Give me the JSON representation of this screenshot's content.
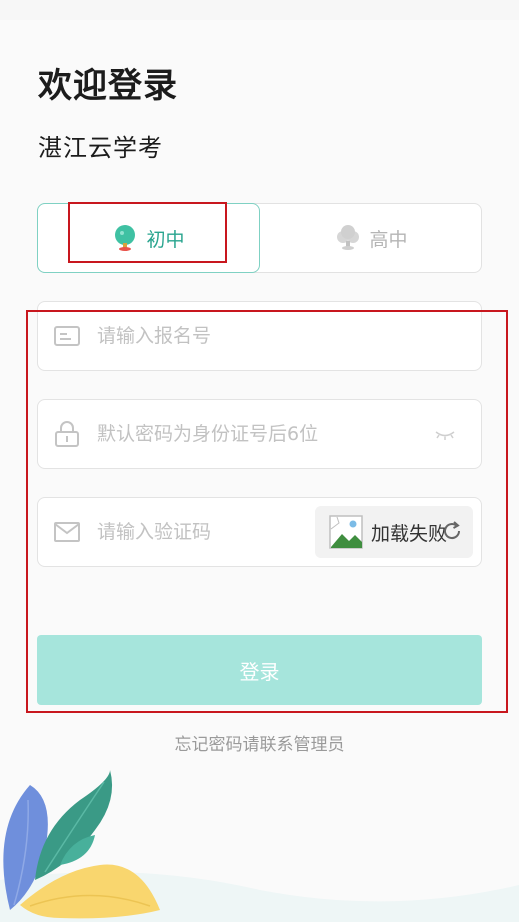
{
  "header": {
    "welcome": "欢迎登录",
    "app_name": "湛江云学考"
  },
  "level_switch": {
    "selected": "初中",
    "options": [
      {
        "label": "初中",
        "icon": "tree-icon",
        "active": true
      },
      {
        "label": "高中",
        "icon": "cloud-tree-icon",
        "active": false
      }
    ]
  },
  "form": {
    "username": {
      "value": "",
      "placeholder": "请输入报名号",
      "icon": "id-card-icon"
    },
    "password": {
      "value": "",
      "placeholder": "默认密码为身份证号后6位",
      "icon": "lock-icon",
      "toggle_icon": "eye-closed-icon"
    },
    "captcha": {
      "value": "",
      "placeholder": "请输入验证码",
      "icon": "mail-icon",
      "image_status": "加载失败",
      "image_icon": "broken-image-icon",
      "refresh_icon": "refresh-icon"
    }
  },
  "login_button": "登录",
  "forgot_text": "忘记密码请联系管理员",
  "colors": {
    "accent": "#2aa58f",
    "accent_border": "#7fd1c3",
    "login_button_bg": "#a6e5dc",
    "annotation_red": "#c8171e",
    "leaf_blue": "#6f8fdc",
    "leaf_green": "#3a9a86",
    "leaf_yellow": "#f9d66e"
  }
}
